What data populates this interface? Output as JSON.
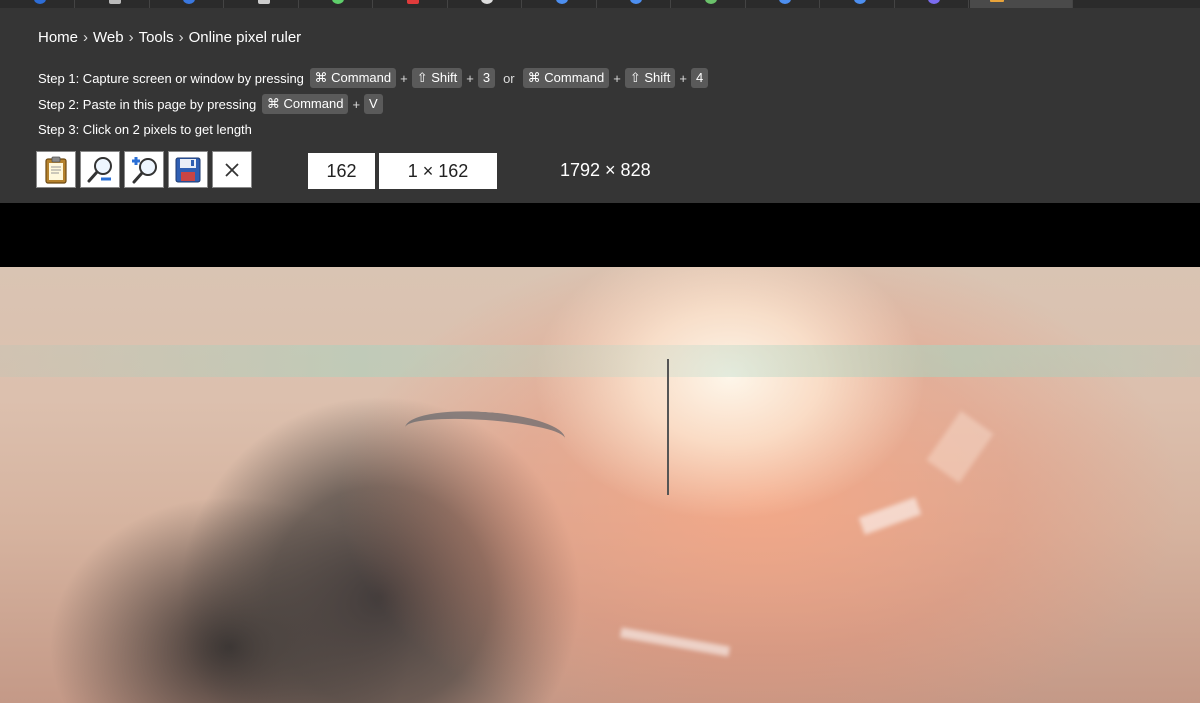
{
  "tabstrip": {
    "tabs": [
      {
        "color": "#2d6dd6",
        "shape": "circle"
      },
      {
        "color": "#bbbbbb",
        "shape": "square"
      },
      {
        "color": "#3a78e0",
        "shape": "circle"
      },
      {
        "color": "#cccccc",
        "shape": "square"
      },
      {
        "color": "#5fcf6b",
        "shape": "circle"
      },
      {
        "color": "#e03b3b",
        "shape": "square"
      },
      {
        "color": "#dddddd",
        "shape": "circle"
      },
      {
        "color": "#4d8ff0",
        "shape": "circle"
      },
      {
        "color": "#4d8ff0",
        "shape": "circle"
      },
      {
        "color": "#6bc26b",
        "shape": "circle"
      },
      {
        "color": "#4d8ff0",
        "shape": "circle"
      },
      {
        "color": "#4d8ff0",
        "shape": "circle"
      },
      {
        "color": "#7b6cf0",
        "shape": "circle"
      }
    ]
  },
  "breadcrumb": {
    "items": [
      "Home",
      "Web",
      "Tools",
      "Online pixel ruler"
    ],
    "separator": "›"
  },
  "steps": {
    "step1": {
      "text": "Step 1: Capture screen or window by pressing",
      "combo1": [
        "⌘ Command",
        "⇧ Shift",
        "3"
      ],
      "or": "or",
      "combo2": [
        "⌘ Command",
        "⇧ Shift",
        "4"
      ]
    },
    "step2": {
      "text": "Step 2: Paste in this page by pressing",
      "combo": [
        "⌘ Command",
        "V"
      ]
    },
    "step3": {
      "text": "Step 3: Click on 2 pixels to get length"
    },
    "plus": "+"
  },
  "toolbar": {
    "buttons": [
      {
        "icon": "clipboard-icon"
      },
      {
        "icon": "zoom-out-icon"
      },
      {
        "icon": "zoom-in-icon"
      },
      {
        "icon": "save-disk-icon"
      },
      {
        "icon": "close-icon"
      }
    ]
  },
  "measurement": {
    "length": "162",
    "vector": "1 × 162",
    "image_size": "1792 × 828"
  },
  "colors": {
    "background": "#353535",
    "key_background": "#5a5a5a",
    "field_background": "#ffffff",
    "black_band": "#000000"
  }
}
